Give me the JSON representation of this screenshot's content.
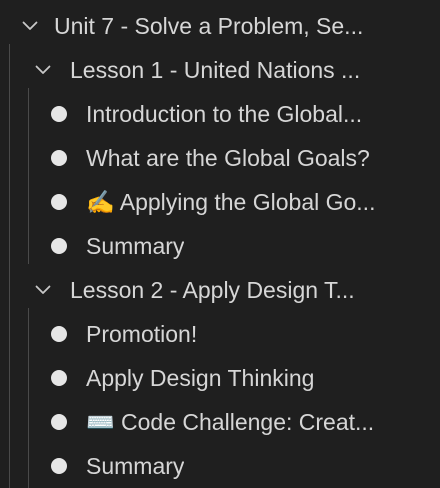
{
  "tree": {
    "unit": {
      "label": "Unit 7 - Solve a Problem, Se...",
      "expanded": true,
      "icon": "chevron-down-icon"
    },
    "lessons": [
      {
        "label": "Lesson 1 - United Nations ...",
        "expanded": true,
        "icon": "chevron-down-icon",
        "items": [
          {
            "label": "Introduction to the Global..."
          },
          {
            "label": "What are the Global Goals?"
          },
          {
            "label": "✍️ Applying the Global Go..."
          },
          {
            "label": "Summary"
          }
        ]
      },
      {
        "label": "Lesson 2 - Apply Design T...",
        "expanded": true,
        "icon": "chevron-down-icon",
        "items": [
          {
            "label": "Promotion!"
          },
          {
            "label": "Apply Design Thinking"
          },
          {
            "label": "⌨️ Code Challenge: Creat..."
          },
          {
            "label": "Summary"
          }
        ]
      }
    ],
    "bullet_icon": "bullet-icon"
  }
}
